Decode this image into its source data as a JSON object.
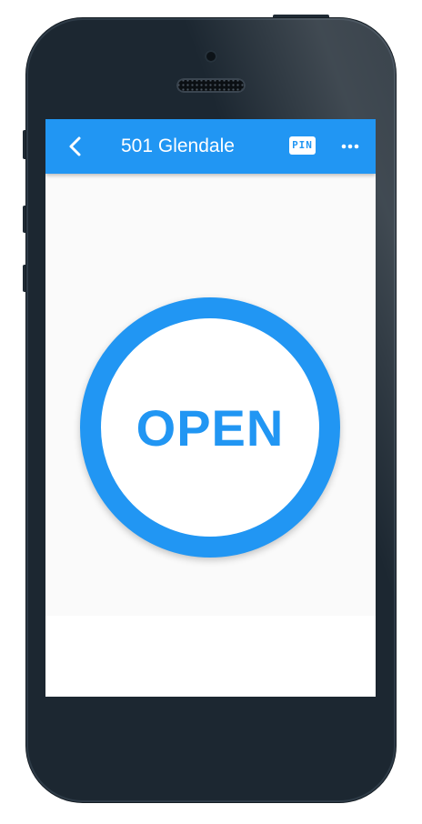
{
  "app_bar": {
    "title": "501 Glendale",
    "back_icon": "chevron-left-icon",
    "pin_label": "PIN",
    "more_icon": "more-horizontal-icon"
  },
  "main": {
    "open_label": "OPEN"
  },
  "colors": {
    "accent": "#2196f3",
    "phone_body": "#1c2731",
    "screen_bg": "#fafafa"
  }
}
